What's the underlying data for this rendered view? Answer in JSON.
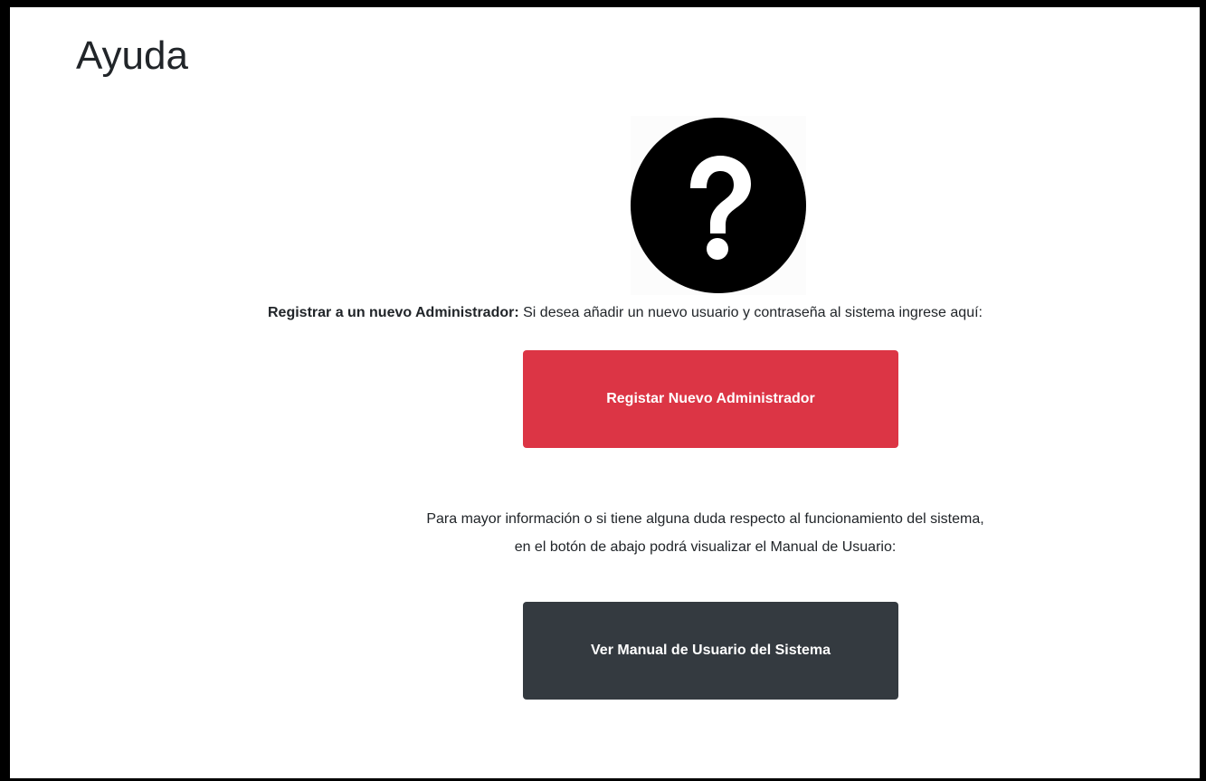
{
  "page": {
    "title": "Ayuda"
  },
  "icons": {
    "help": "question-circle-icon"
  },
  "register_section": {
    "label_bold": "Registrar a un nuevo Administrador:",
    "label_text": " Si desea añadir un nuevo usuario y contraseña al sistema ingrese aquí:",
    "button_label": "Registar Nuevo Administrador"
  },
  "manual_section": {
    "line1": "Para mayor información o si tiene alguna duda respecto al funcionamiento del sistema,",
    "line2": "en el botón de abajo podrá visualizar el Manual de Usuario:",
    "button_label": "Ver Manual de Usuario del Sistema"
  },
  "colors": {
    "danger": "#dc3545",
    "dark": "#343a40",
    "text": "#212529"
  }
}
